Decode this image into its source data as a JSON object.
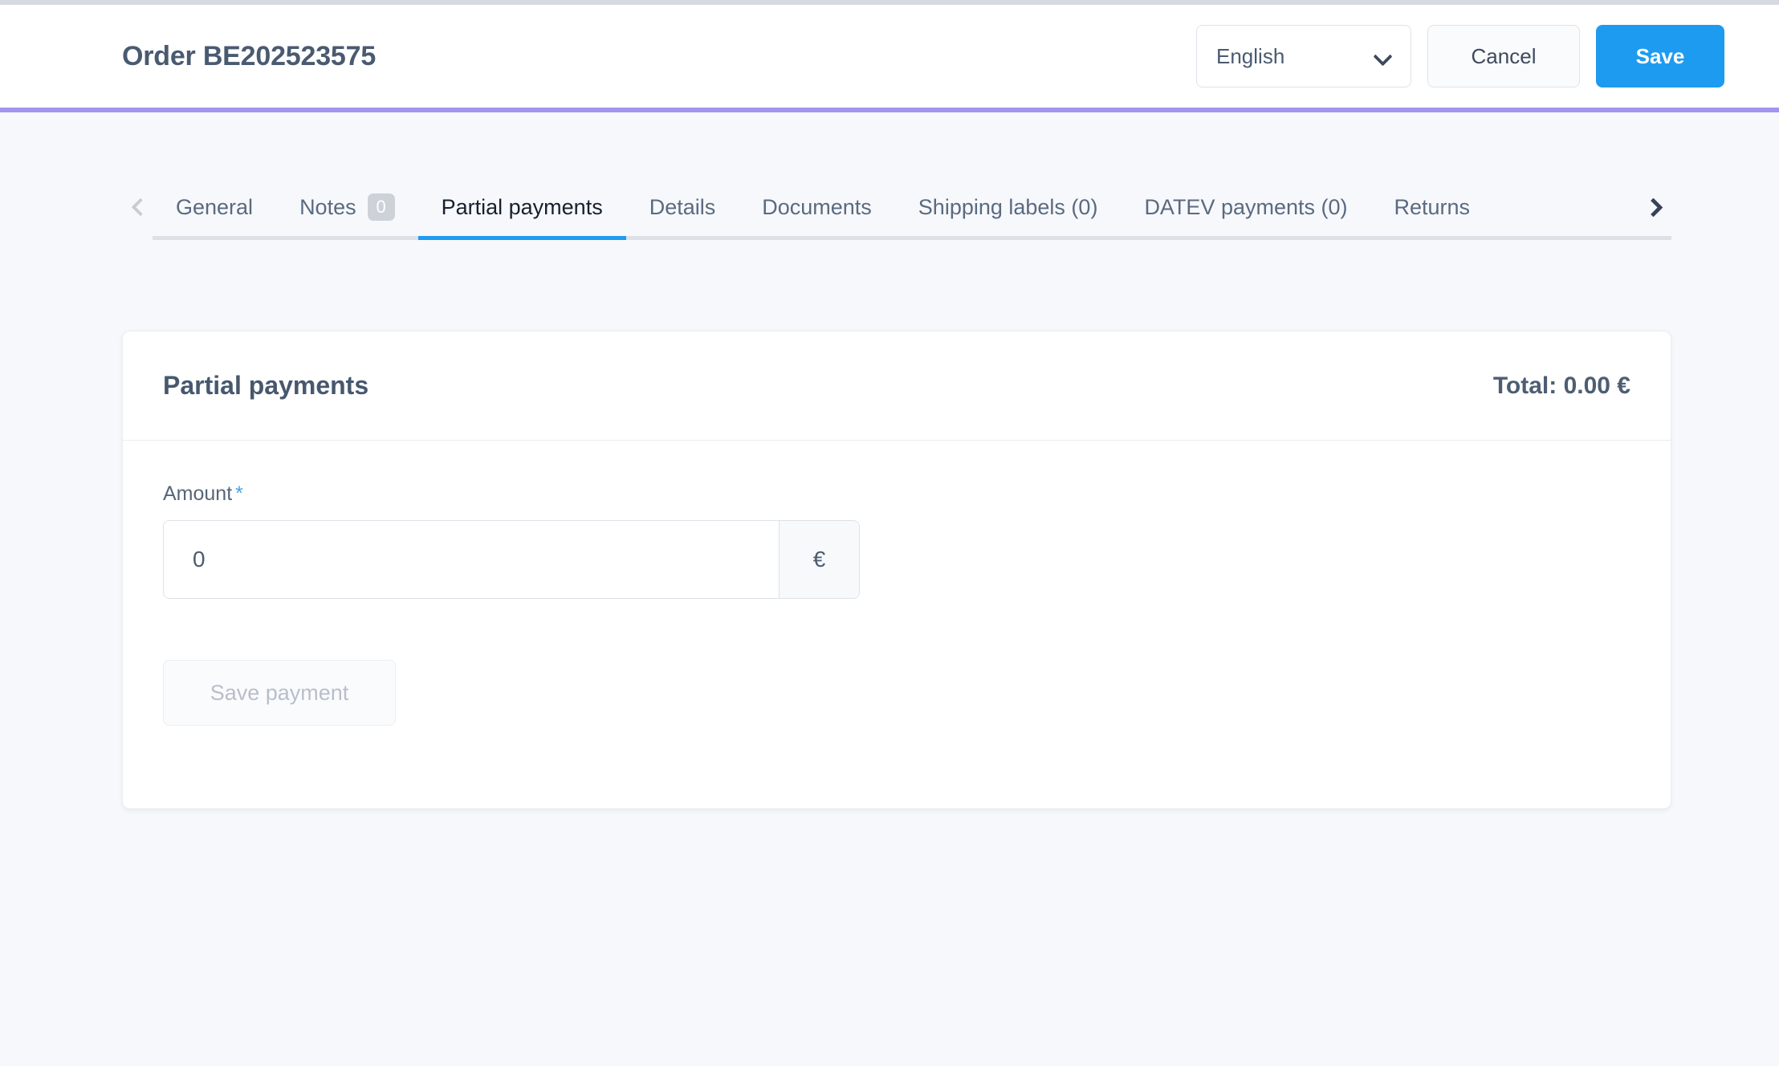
{
  "header": {
    "title": "Order BE202523575",
    "language": {
      "value": "English",
      "icon": "chevron-down-icon"
    },
    "cancel_label": "Cancel",
    "save_label": "Save",
    "accent_underline_color": "#a295f0",
    "save_button_color": "#1d9bf0"
  },
  "tabs": {
    "prev_icon": "chevron-left-icon",
    "next_icon": "chevron-right-icon",
    "active_index": 2,
    "active_color": "#1d9bf0",
    "items": [
      {
        "label": "General",
        "badge": null
      },
      {
        "label": "Notes",
        "badge": "0"
      },
      {
        "label": "Partial payments",
        "badge": null
      },
      {
        "label": "Details",
        "badge": null
      },
      {
        "label": "Documents",
        "badge": null
      },
      {
        "label": "Shipping labels (0)",
        "badge": null
      },
      {
        "label": "DATEV payments (0)",
        "badge": null
      },
      {
        "label": "Returns",
        "badge": null
      }
    ]
  },
  "card": {
    "title": "Partial payments",
    "total": "Total: 0.00 €",
    "form": {
      "amount_label": "Amount",
      "required_marker": "*",
      "amount_value": "0",
      "amount_placeholder": "0",
      "currency_addon": "€",
      "save_payment_label": "Save payment"
    }
  }
}
